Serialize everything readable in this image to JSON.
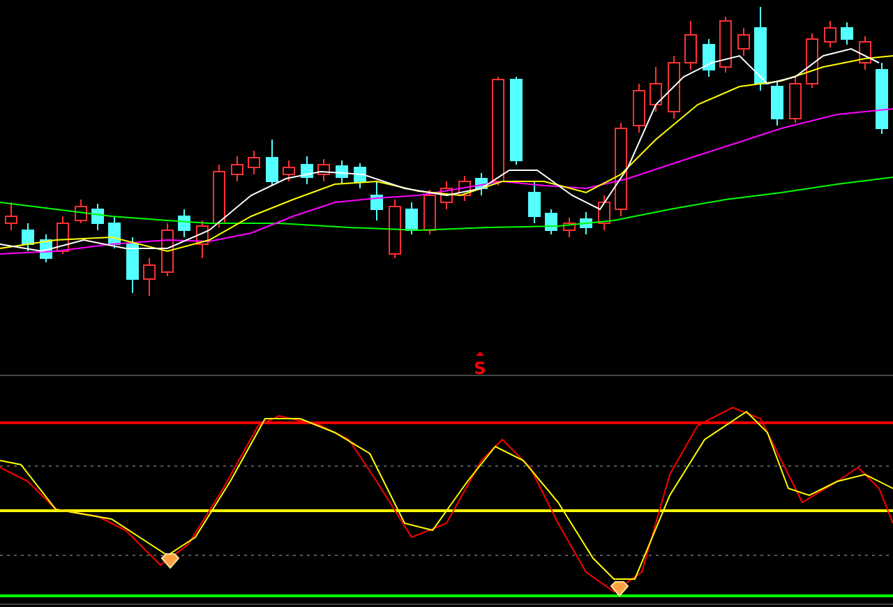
{
  "indicator_panel": {
    "signal_label": "S"
  }
}
